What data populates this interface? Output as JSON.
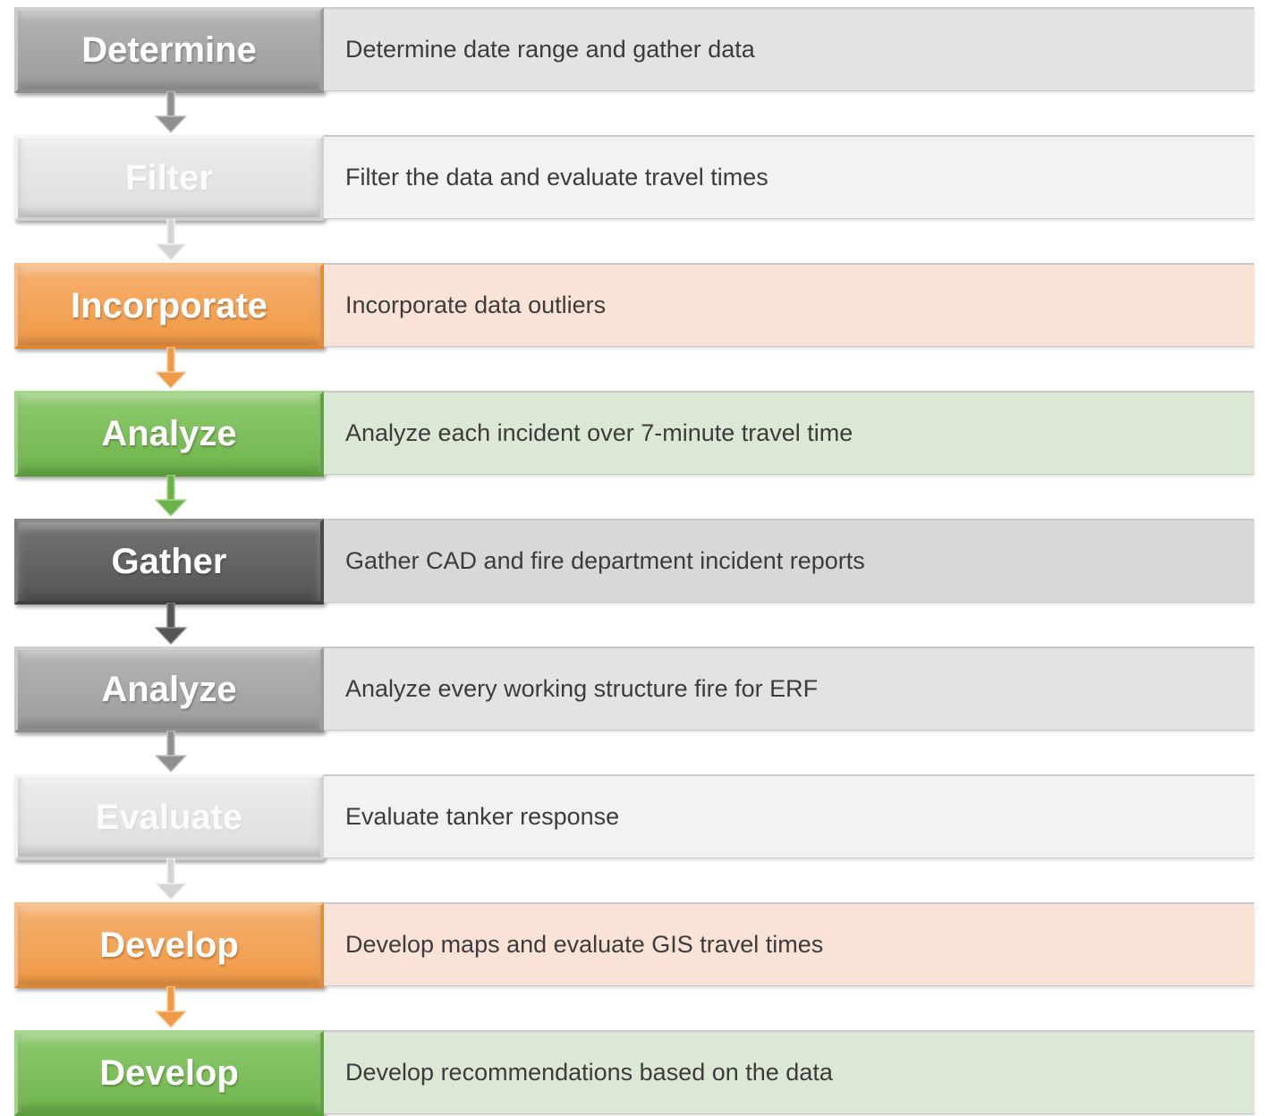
{
  "steps": [
    {
      "label": "Determine",
      "description": "Determine date range and gather data",
      "color": "gray"
    },
    {
      "label": "Filter",
      "description": "Filter the data and evaluate travel times",
      "color": "light"
    },
    {
      "label": "Incorporate",
      "description": "Incorporate data outliers",
      "color": "orange"
    },
    {
      "label": "Analyze",
      "description": "Analyze each incident over 7-minute travel time",
      "color": "green"
    },
    {
      "label": "Gather",
      "description": "Gather CAD and fire department incident reports",
      "color": "dark"
    },
    {
      "label": "Analyze",
      "description": "Analyze every working structure fire for ERF",
      "color": "gray"
    },
    {
      "label": "Evaluate",
      "description": "Evaluate tanker response",
      "color": "light"
    },
    {
      "label": "Develop",
      "description": "Develop maps and evaluate GIS travel times",
      "color": "orange"
    },
    {
      "label": "Develop",
      "description": "Develop recommendations based on the data",
      "color": "green"
    }
  ],
  "palette": {
    "gray": {
      "arrow": "#8f8f8f",
      "arrow_light": "#c4c4c4"
    },
    "light": {
      "arrow": "#d4d4d4",
      "arrow_light": "#f2f2f2"
    },
    "orange": {
      "arrow": "#ee9a48",
      "arrow_light": "#f9cfa3"
    },
    "green": {
      "arrow": "#6cb24a",
      "arrow_light": "#a9d98f"
    },
    "dark": {
      "arrow": "#555555",
      "arrow_light": "#8a8a8a"
    }
  }
}
